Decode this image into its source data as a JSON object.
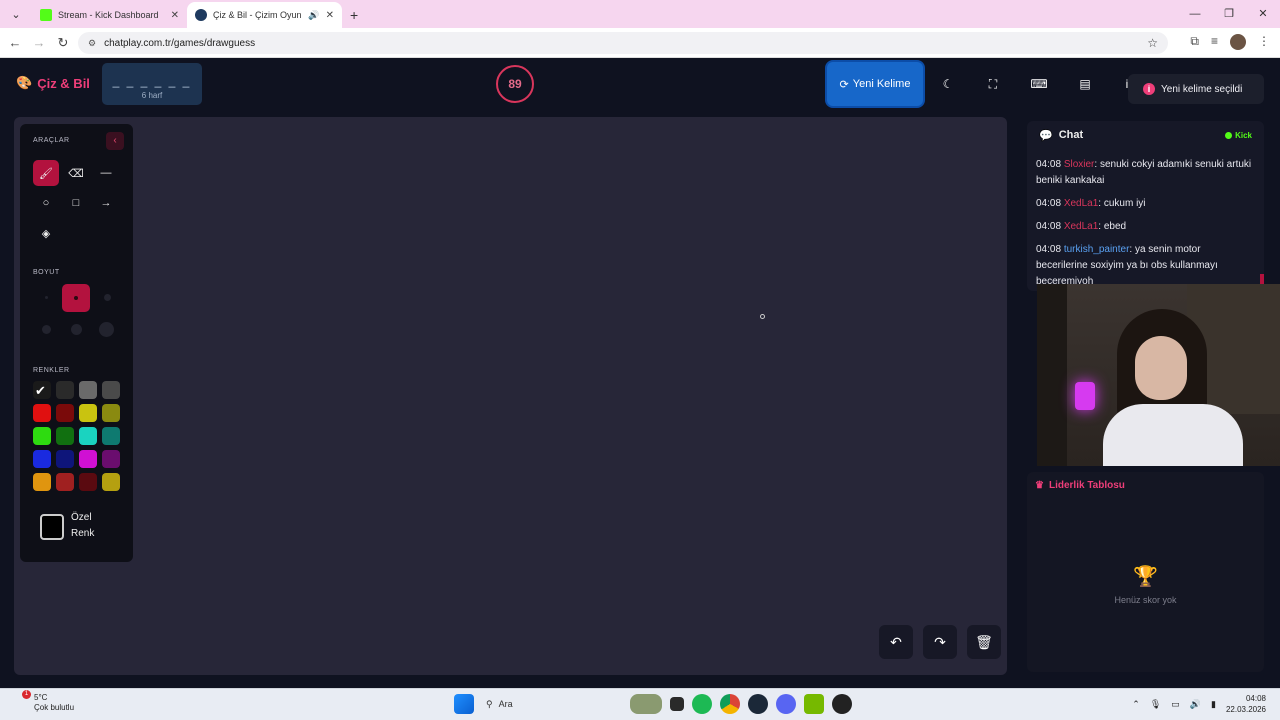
{
  "browser": {
    "tabs": [
      {
        "title": "Stream - Kick Dashboard",
        "favicon_color": "#53fc18"
      },
      {
        "title": "Çiz & Bil - Çizim Oyunu",
        "favicon_color": "#1e3a5f"
      }
    ],
    "url": "chatplay.com.tr/games/drawguess",
    "new_tab_label": "+"
  },
  "header": {
    "logo_text": "Çiz & Bil",
    "word_dashes": "_ _ _ _ _ _",
    "word_length": "6 harf",
    "timer": "89",
    "new_word_label": "Yeni Kelime",
    "toast_text": "Yeni kelime seçildi",
    "toast_icon": "i"
  },
  "tools": {
    "section_tools": "ARAÇLAR",
    "section_size": "BOYUT",
    "section_colors": "RENKLER",
    "custom_color_line1": "Özel",
    "custom_color_line2": "Renk",
    "colors": [
      "#1a1a1a",
      "#2a2a2a",
      "#6a6a6a",
      "#4a4a4a",
      "#e01010",
      "#7a0a0a",
      "#c9c310",
      "#8a8a10",
      "#2edb10",
      "#117010",
      "#1ad3c0",
      "#0e7a70",
      "#1a2ae0",
      "#0e157a",
      "#d010d3",
      "#6a0d6e",
      "#e0950f",
      "#a02020",
      "#5a0a10",
      "#b5a010"
    ]
  },
  "chat": {
    "title": "Chat",
    "platform": "Kick",
    "messages": [
      {
        "time": "04:08",
        "user": "Sloxier",
        "text": ": senuki cokyi adamıki senuki artuki beniki kankakai"
      },
      {
        "time": "04:08",
        "user": "XedLa1",
        "text": ": cukum iyi"
      },
      {
        "time": "04:08",
        "user": "XedLa1",
        "text": ": ebed"
      },
      {
        "time": "04:08",
        "user": "turkish_painter",
        "text": ": ya senin motor becerilerine soxiyim ya bı obs kullanmayı beceremiyoh"
      }
    ]
  },
  "leaderboard": {
    "title": "Liderlik Tablosu",
    "empty_text": "Henüz skor yok"
  },
  "taskbar": {
    "temperature": "5°C",
    "weather": "Çok bulutlu",
    "weather_badge": "1",
    "search_label": "Ara",
    "time": "04:08",
    "date": "22.03.2026"
  }
}
